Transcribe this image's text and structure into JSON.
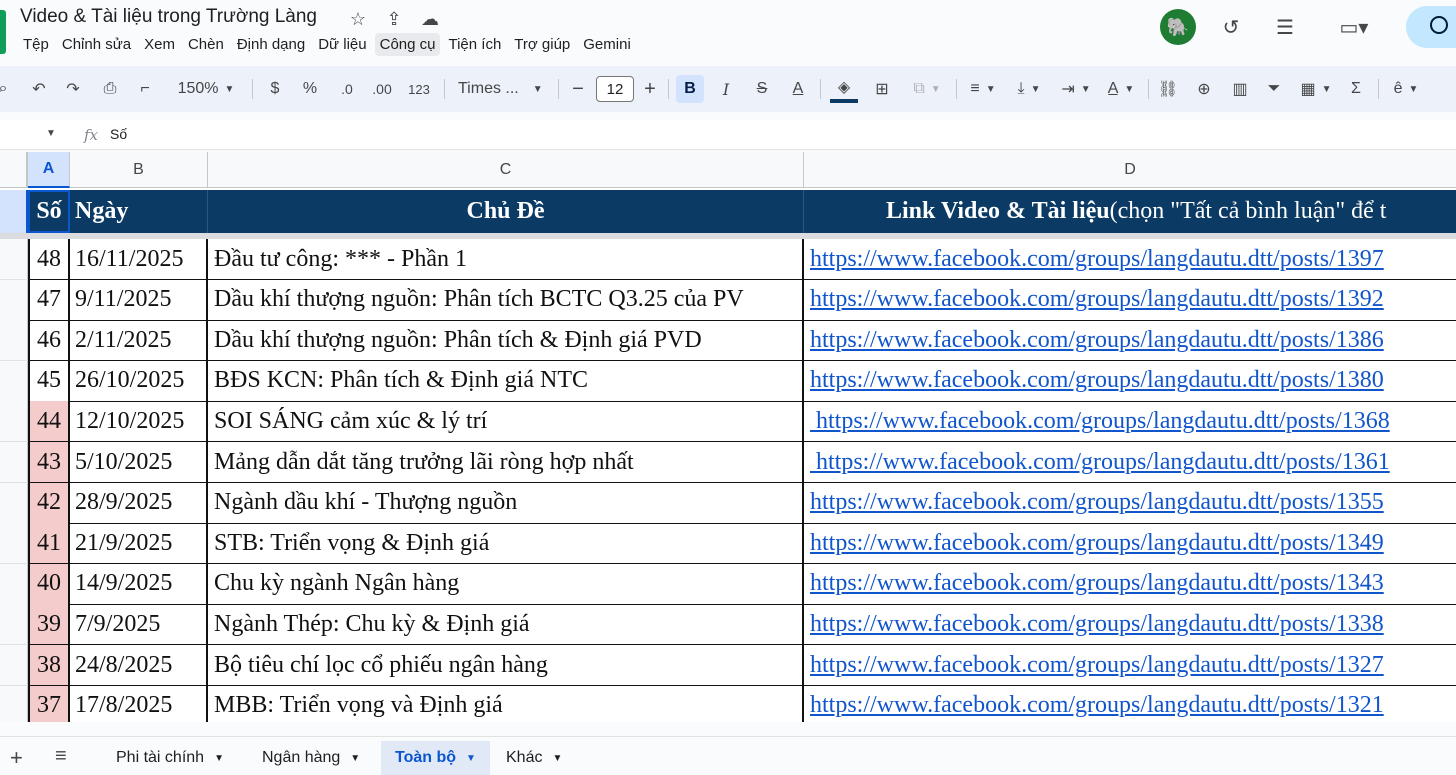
{
  "window": {
    "title": "Video & Tài liệu trong Trường Làng"
  },
  "menu": [
    "Tệp",
    "Chỉnh sửa",
    "Xem",
    "Chèn",
    "Định dạng",
    "Dữ liệu",
    "Công cụ",
    "Tiện ích",
    "Trợ giúp",
    "Gemini"
  ],
  "menu_active": "Công cụ",
  "toolbar": {
    "zoom": "150%",
    "currency": "$",
    "percent": "%",
    "decrease_decimal": ".0",
    "increase_decimal": ".00",
    "number_format": "123",
    "font_family": "Times ...",
    "font_size": "12",
    "bold": "B",
    "italic": "I",
    "strikethrough": "S",
    "text_color": "A"
  },
  "formula_bar": {
    "fx": "fx",
    "content": "Số"
  },
  "columns": [
    "A",
    "B",
    "C",
    "D"
  ],
  "selected_column": "A",
  "header": {
    "so": "Số",
    "ngay": "Ngày",
    "chu_de": "Chủ Đề",
    "link_bold": "Link Video & Tài liệu",
    "link_note": " (chọn \"Tất cả bình luận\" để t"
  },
  "rows": [
    {
      "so": "48",
      "ngay": "16/11/2025",
      "chu_de": "Đầu tư công: *** - Phần 1",
      "link": "https://www.facebook.com/groups/langdautu.dtt/posts/1397",
      "highlight": false
    },
    {
      "so": "47",
      "ngay": "9/11/2025",
      "chu_de": "Dầu khí thượng nguồn: Phân tích BCTC Q3.25 của PV",
      "link": "https://www.facebook.com/groups/langdautu.dtt/posts/1392",
      "highlight": false
    },
    {
      "so": "46",
      "ngay": "2/11/2025",
      "chu_de": "Dầu khí thượng nguồn: Phân tích & Định giá PVD",
      "link": "https://www.facebook.com/groups/langdautu.dtt/posts/1386",
      "highlight": false
    },
    {
      "so": "45",
      "ngay": "26/10/2025",
      "chu_de": "BĐS KCN: Phân tích & Định giá NTC",
      "link": "https://www.facebook.com/groups/langdautu.dtt/posts/1380",
      "highlight": false
    },
    {
      "so": "44",
      "ngay": "12/10/2025",
      "chu_de": "SOI SÁNG cảm xúc & lý trí",
      "link": " https://www.facebook.com/groups/langdautu.dtt/posts/1368",
      "highlight": true
    },
    {
      "so": "43",
      "ngay": "5/10/2025",
      "chu_de": "Mảng dẫn dắt tăng trưởng lãi ròng hợp nhất",
      "link": " https://www.facebook.com/groups/langdautu.dtt/posts/1361",
      "highlight": true
    },
    {
      "so": "42",
      "ngay": "28/9/2025",
      "chu_de": "Ngành dầu khí - Thượng nguồn",
      "link": "https://www.facebook.com/groups/langdautu.dtt/posts/1355",
      "highlight": true
    },
    {
      "so": "41",
      "ngay": "21/9/2025",
      "chu_de": "STB: Triển vọng & Định giá",
      "link": "https://www.facebook.com/groups/langdautu.dtt/posts/1349",
      "highlight": true
    },
    {
      "so": "40",
      "ngay": "14/9/2025",
      "chu_de": "Chu kỳ ngành Ngân hàng",
      "link": "https://www.facebook.com/groups/langdautu.dtt/posts/1343",
      "highlight": true
    },
    {
      "so": "39",
      "ngay": "7/9/2025",
      "chu_de": "Ngành Thép: Chu kỳ & Định giá",
      "link": "https://www.facebook.com/groups/langdautu.dtt/posts/1338",
      "highlight": true
    },
    {
      "so": "38",
      "ngay": "24/8/2025",
      "chu_de": "Bộ tiêu chí lọc cổ phiếu ngân hàng",
      "link": "https://www.facebook.com/groups/langdautu.dtt/posts/1327",
      "highlight": true
    },
    {
      "so": "37",
      "ngay": "17/8/2025",
      "chu_de": "MBB: Triển vọng và Định giá",
      "link": "https://www.facebook.com/groups/langdautu.dtt/posts/1321",
      "highlight": true
    }
  ],
  "sheet_tabs": [
    "Phi tài chính",
    "Ngân hàng",
    "Toàn bộ",
    "Khác"
  ],
  "active_tab": "Toàn bộ",
  "colors": {
    "header_bg": "#0b3a64",
    "highlight_bg": "#f4cccc",
    "link": "#1155cc",
    "accent": "#0b57d0"
  }
}
